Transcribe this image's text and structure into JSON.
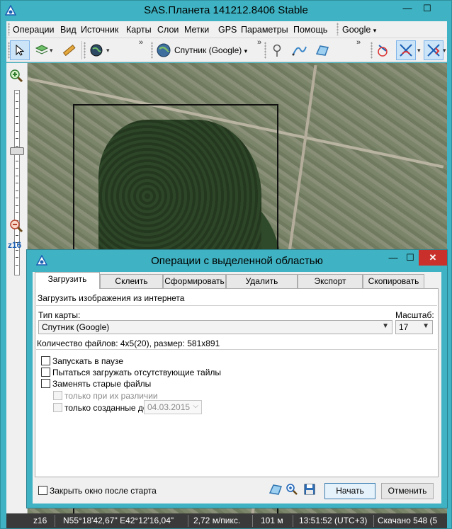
{
  "main_window": {
    "title": "SAS.Планета 141212.8406 Stable",
    "controls": {
      "minimize": "—",
      "maximize": "☐",
      "close": "✕"
    }
  },
  "menu": {
    "items": [
      "Операции",
      "Вид",
      "Источник",
      "Карты",
      "Слои",
      "Метки",
      "GPS",
      "Параметры",
      "Помощь"
    ],
    "search_provider": "Google"
  },
  "toolbar": {
    "map_source": "Спутник (Google)",
    "icons": [
      "cursor-icon",
      "map-layer-icon",
      "ruler-icon",
      "globe-icon",
      "satellite-globe-icon",
      "pin-icon",
      "route-icon",
      "area-icon",
      "gps-icon",
      "gps-track-icon",
      "gps-center-icon"
    ]
  },
  "zoom": {
    "level_label": "z16",
    "level": 16,
    "max_level": 24
  },
  "status_bar": {
    "zoom": "z16",
    "coords": "N55°18'42,67\" E42°12'16,04\"",
    "scale": "2,72 м/пикс.",
    "distance": "101 м",
    "time": "13:51:52 (UTC+3)",
    "downloaded": "Скачано 548 (5"
  },
  "dialog": {
    "title": "Операции с выделенной областью",
    "controls": {
      "minimize": "—",
      "maximize": "☐",
      "close": "✕"
    },
    "tabs": [
      "Загрузить",
      "Склеить",
      "Сформировать",
      "Удалить",
      "Экспорт",
      "Скопировать"
    ],
    "active_tab": 0,
    "panel": {
      "heading": "Загрузить изображения из интернета",
      "map_type_label": "Тип карты:",
      "map_type_value": "Спутник (Google)",
      "scale_label": "Масштаб:",
      "scale_value": "17",
      "files_info": "Количество файлов: 4x5(20), размер: 581x891",
      "options": [
        {
          "label": "Запускать в паузе",
          "checked": false,
          "enabled": true
        },
        {
          "label": "Пытаться загружать отсутствующие тайлы",
          "checked": false,
          "enabled": true
        },
        {
          "label": "Заменять старые файлы",
          "checked": false,
          "enabled": true
        },
        {
          "label": "только при их различии",
          "checked": false,
          "enabled": false
        },
        {
          "label": "только созданные до",
          "checked": false,
          "enabled": false
        }
      ],
      "date_value": "04.03.2015"
    },
    "footer": {
      "close_after_start": "Закрыть окно после старта",
      "start_button": "Начать",
      "cancel_button": "Отменить"
    }
  }
}
